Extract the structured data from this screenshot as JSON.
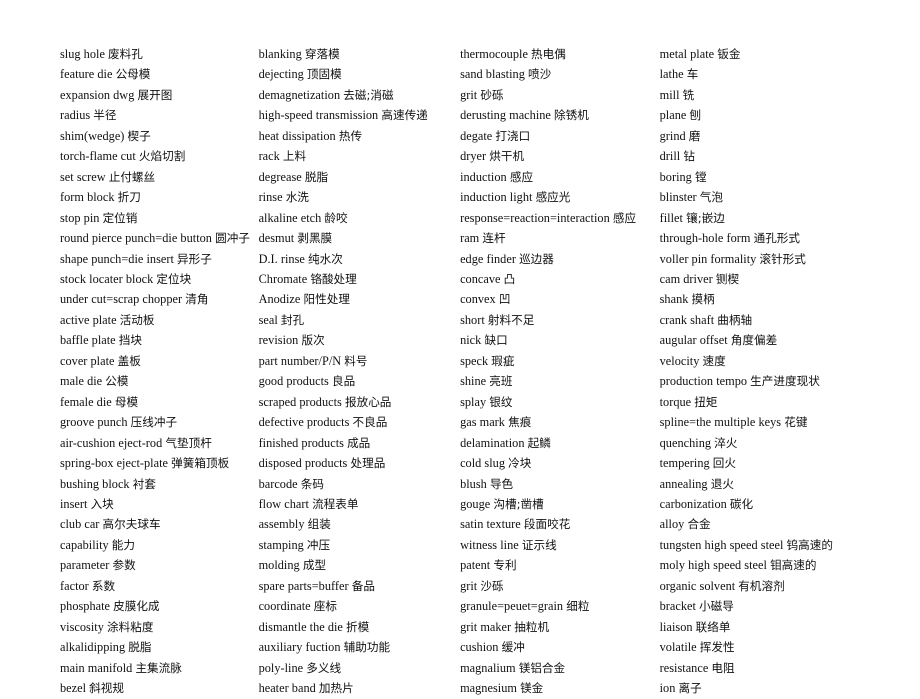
{
  "document": {
    "type": "bilingual-glossary",
    "title": "",
    "page_background": "#ffffff",
    "text_color": "#111111",
    "column_count": 4
  },
  "columns": [
    {
      "id": "column-1",
      "entries": [
        {
          "term": "slug hole",
          "gloss": "废料孔"
        },
        {
          "term": "feature die",
          "gloss": "公母模"
        },
        {
          "term": "expansion dwg",
          "gloss": "展开图"
        },
        {
          "term": "radius",
          "gloss": "半径"
        },
        {
          "term": "shim(wedge)",
          "gloss": "楔子"
        },
        {
          "term": "torch-flame cut",
          "gloss": "火焰切割"
        },
        {
          "term": "set screw",
          "gloss": "止付螺丝"
        },
        {
          "term": "form block",
          "gloss": "折刀"
        },
        {
          "term": "stop pin",
          "gloss": "定位销"
        },
        {
          "term": "round pierce punch=die button",
          "gloss": "圆冲子"
        },
        {
          "term": "shape punch=die insert",
          "gloss": "异形子"
        },
        {
          "term": "stock locater block",
          "gloss": "定位块"
        },
        {
          "term": "under cut=scrap chopper",
          "gloss": "清角"
        },
        {
          "term": "active plate",
          "gloss": "活动板"
        },
        {
          "term": "baffle plate",
          "gloss": "挡块"
        },
        {
          "term": "cover plate",
          "gloss": "盖板"
        },
        {
          "term": "male die",
          "gloss": "公模"
        },
        {
          "term": "female die",
          "gloss": "母模"
        },
        {
          "term": "groove punch",
          "gloss": "压线冲子"
        },
        {
          "term": "air-cushion eject-rod",
          "gloss": "气垫顶杆"
        },
        {
          "term": "spring-box eject-plate",
          "gloss": "弹簧箱顶板"
        },
        {
          "term": "bushing block",
          "gloss": "衬套"
        },
        {
          "term": "insert",
          "gloss": "入块"
        },
        {
          "term": "club car",
          "gloss": "高尔夫球车"
        },
        {
          "term": "capability",
          "gloss": "能力"
        },
        {
          "term": "parameter",
          "gloss": "参数"
        },
        {
          "term": "factor",
          "gloss": "系数"
        },
        {
          "term": "phosphate",
          "gloss": "皮膜化成"
        },
        {
          "term": "viscosity",
          "gloss": "涂料粘度"
        },
        {
          "term": "alkalidipping",
          "gloss": "脱脂"
        },
        {
          "term": "main manifold",
          "gloss": "主集流脉"
        },
        {
          "term": "bezel",
          "gloss": "斜视规"
        }
      ]
    },
    {
      "id": "column-2",
      "entries": [
        {
          "term": "blanking",
          "gloss": "穿落模"
        },
        {
          "term": "dejecting",
          "gloss": "顶固模"
        },
        {
          "term": "demagnetization",
          "gloss": "去磁;消磁"
        },
        {
          "term": "high-speed transmission",
          "gloss": "高速传递"
        },
        {
          "term": "heat dissipation",
          "gloss": "热传"
        },
        {
          "term": "rack",
          "gloss": "上料"
        },
        {
          "term": "degrease",
          "gloss": "脱脂"
        },
        {
          "term": "rinse",
          "gloss": "水洗"
        },
        {
          "term": "alkaline etch",
          "gloss": "龄咬"
        },
        {
          "term": "desmut",
          "gloss": "剥黑膜"
        },
        {
          "term": "D.I. rinse",
          "gloss": "纯水次"
        },
        {
          "term": "Chromate",
          "gloss": "铬酸处理"
        },
        {
          "term": "Anodize",
          "gloss": "阳性处理"
        },
        {
          "term": "seal",
          "gloss": "封孔"
        },
        {
          "term": "revision",
          "gloss": "版次"
        },
        {
          "term": "part number/P/N",
          "gloss": "料号"
        },
        {
          "term": "good products",
          "gloss": "良品"
        },
        {
          "term": "scraped products",
          "gloss": "报放心品"
        },
        {
          "term": "defective products",
          "gloss": "不良品"
        },
        {
          "term": "finished products",
          "gloss": "成品"
        },
        {
          "term": "disposed products",
          "gloss": "处理品"
        },
        {
          "term": "barcode",
          "gloss": "条码"
        },
        {
          "term": "flow chart",
          "gloss": "流程表单"
        },
        {
          "term": "assembly",
          "gloss": "组装"
        },
        {
          "term": "stamping",
          "gloss": "冲压"
        },
        {
          "term": "molding",
          "gloss": "成型"
        },
        {
          "term": "spare parts=buffer",
          "gloss": "备品"
        },
        {
          "term": "coordinate",
          "gloss": "座标"
        },
        {
          "term": "dismantle the die",
          "gloss": "折模"
        },
        {
          "term": "auxiliary fuction",
          "gloss": "辅助功能"
        },
        {
          "term": "poly-line",
          "gloss": "多义线"
        },
        {
          "term": "heater band",
          "gloss": "加热片"
        }
      ]
    },
    {
      "id": "column-3",
      "entries": [
        {
          "term": "thermocouple",
          "gloss": "热电偶"
        },
        {
          "term": "sand blasting",
          "gloss": "喷沙"
        },
        {
          "term": "grit",
          "gloss": "砂砾"
        },
        {
          "term": "derusting machine",
          "gloss": "除锈机"
        },
        {
          "term": "degate",
          "gloss": "打浇口"
        },
        {
          "term": "dryer",
          "gloss": "烘干机"
        },
        {
          "term": "induction",
          "gloss": "感应"
        },
        {
          "term": "induction light",
          "gloss": "感应光"
        },
        {
          "term": "response=reaction=interaction",
          "gloss": "感应"
        },
        {
          "term": "ram",
          "gloss": "连杆"
        },
        {
          "term": "edge finder",
          "gloss": "巡边器"
        },
        {
          "term": "concave",
          "gloss": "凸"
        },
        {
          "term": "convex",
          "gloss": "凹"
        },
        {
          "term": "short",
          "gloss": "射料不足"
        },
        {
          "term": "nick",
          "gloss": "缺口"
        },
        {
          "term": "speck",
          "gloss": "瑕疵"
        },
        {
          "term": "shine",
          "gloss": "亮班"
        },
        {
          "term": "splay",
          "gloss": "银纹"
        },
        {
          "term": "gas mark",
          "gloss": "焦痕"
        },
        {
          "term": "delamination",
          "gloss": "起鳞"
        },
        {
          "term": "cold slug",
          "gloss": "冷块"
        },
        {
          "term": "blush",
          "gloss": "导色"
        },
        {
          "term": "gouge",
          "gloss": "沟槽;凿槽"
        },
        {
          "term": "satin texture",
          "gloss": "段面咬花"
        },
        {
          "term": "witness line",
          "gloss": "证示线"
        },
        {
          "term": "patent",
          "gloss": "专利"
        },
        {
          "term": "grit",
          "gloss": "沙砾"
        },
        {
          "term": "granule=peuet=grain",
          "gloss": "细粒"
        },
        {
          "term": "grit maker",
          "gloss": "抽粒机"
        },
        {
          "term": "cushion",
          "gloss": "缓冲"
        },
        {
          "term": "magnalium",
          "gloss": "镁铝合金"
        },
        {
          "term": "magnesium",
          "gloss": "镁金"
        }
      ]
    },
    {
      "id": "column-4",
      "entries": [
        {
          "term": "metal plate",
          "gloss": "钣金"
        },
        {
          "term": "lathe",
          "gloss": "车"
        },
        {
          "term": "mill",
          "gloss": "铣"
        },
        {
          "term": "plane",
          "gloss": "刨"
        },
        {
          "term": "grind",
          "gloss": "磨"
        },
        {
          "term": "drill",
          "gloss": "钻"
        },
        {
          "term": "boring",
          "gloss": "镗"
        },
        {
          "term": "blinster",
          "gloss": "气泡"
        },
        {
          "term": "fillet",
          "gloss": "镶;嵌边"
        },
        {
          "term": "through-hole form",
          "gloss": "通孔形式"
        },
        {
          "term": "voller pin formality",
          "gloss": "滚针形式"
        },
        {
          "term": "cam driver",
          "gloss": "铡楔"
        },
        {
          "term": "shank",
          "gloss": "摸柄"
        },
        {
          "term": "crank shaft",
          "gloss": "曲柄轴"
        },
        {
          "term": "augular offset",
          "gloss": "角度偏差"
        },
        {
          "term": "velocity",
          "gloss": "速度"
        },
        {
          "term": "production tempo",
          "gloss": "生产进度现状"
        },
        {
          "term": "torque",
          "gloss": "扭矩"
        },
        {
          "term": "spline=the multiple keys",
          "gloss": "花键"
        },
        {
          "term": "quenching",
          "gloss": "淬火"
        },
        {
          "term": "tempering",
          "gloss": "回火"
        },
        {
          "term": "annealing",
          "gloss": "退火"
        },
        {
          "term": "carbonization",
          "gloss": "碳化"
        },
        {
          "term": "alloy",
          "gloss": "合金"
        },
        {
          "term": "tungsten high speed steel",
          "gloss": "钨高速的"
        },
        {
          "term": "moly high speed steel",
          "gloss": "钼高速的"
        },
        {
          "term": "organic solvent",
          "gloss": "有机溶剂"
        },
        {
          "term": "bracket",
          "gloss": "小磁导"
        },
        {
          "term": "liaison",
          "gloss": "联络单"
        },
        {
          "term": "volatile",
          "gloss": "挥发性"
        },
        {
          "term": "resistance",
          "gloss": "电阻"
        },
        {
          "term": "ion",
          "gloss": "离子"
        }
      ]
    }
  ]
}
